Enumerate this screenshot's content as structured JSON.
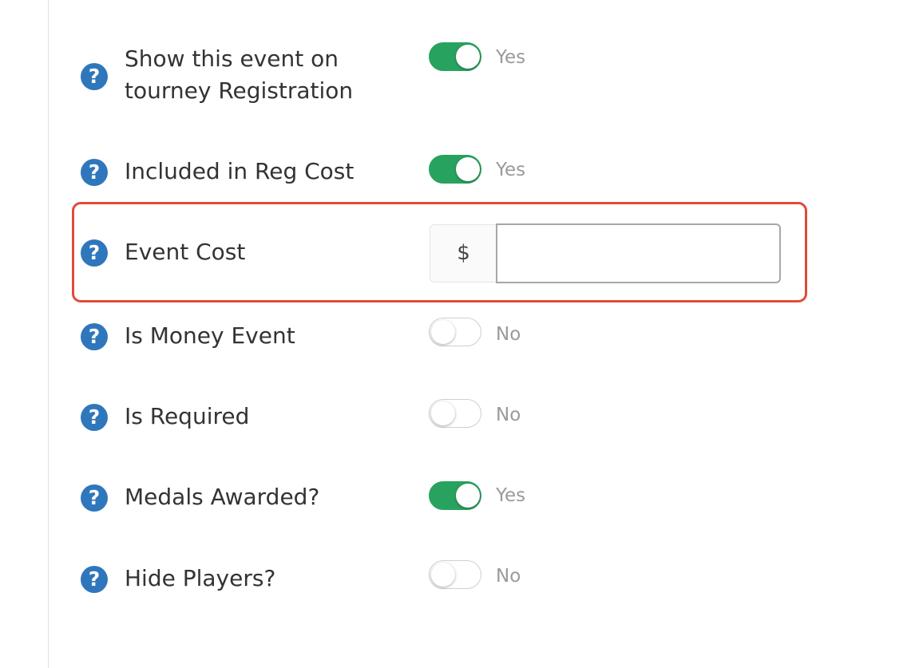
{
  "help_icon_glyph": "?",
  "rows": [
    {
      "label_line1": "Show this event on",
      "label_line2": "tourney Registration",
      "toggle_on": true,
      "toggle_text": "Yes"
    },
    {
      "label": "Included in Reg Cost",
      "toggle_on": true,
      "toggle_text": "Yes"
    },
    {
      "label": "Event Cost",
      "currency_symbol": "$",
      "input_value": ""
    },
    {
      "label": "Is Money Event",
      "toggle_on": false,
      "toggle_text": "No"
    },
    {
      "label": "Is Required",
      "toggle_on": false,
      "toggle_text": "No"
    },
    {
      "label": "Medals Awarded?",
      "toggle_on": true,
      "toggle_text": "Yes"
    },
    {
      "label": "Hide Players?",
      "toggle_on": false,
      "toggle_text": "No"
    }
  ],
  "colors": {
    "toggle_on": "#28a35f",
    "help_icon": "#2f77bc",
    "highlight_border": "#e04b3a"
  },
  "icons": {
    "help": "question-circle-icon"
  }
}
